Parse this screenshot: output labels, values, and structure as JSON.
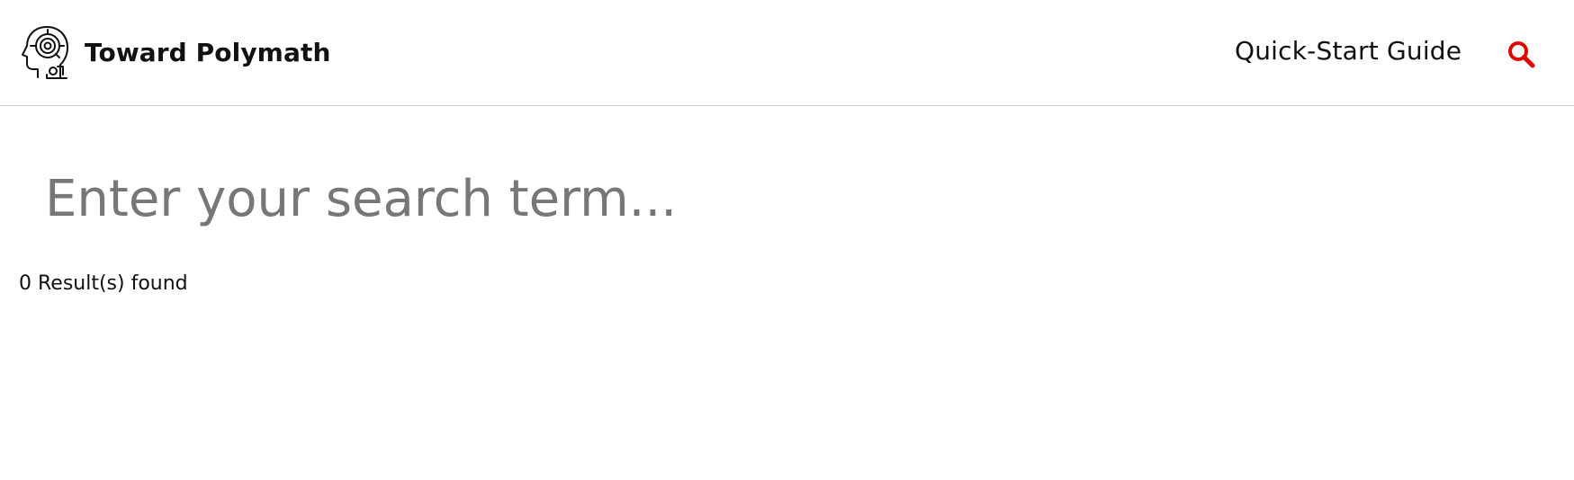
{
  "header": {
    "brand_title": "Toward Polymath",
    "logo_icon": "ai-head-icon",
    "nav_link": "Quick-Start Guide",
    "search_icon": "search-icon",
    "accent_color": "#e10600"
  },
  "search": {
    "placeholder": "Enter your search term...",
    "value": "",
    "result_count": "0 Result(s) found"
  }
}
